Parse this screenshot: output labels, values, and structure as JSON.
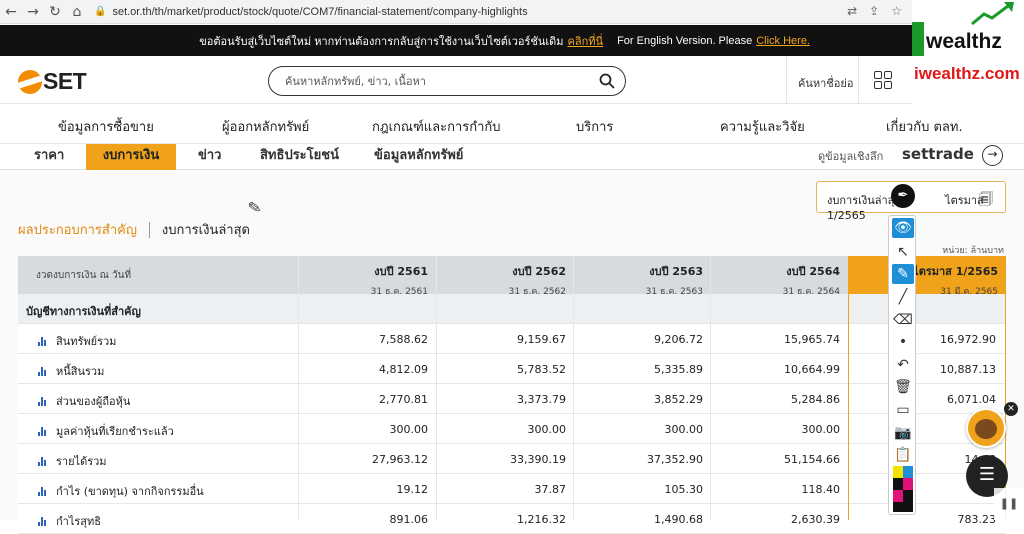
{
  "browser": {
    "url": "set.or.th/th/market/product/stock/quote/COM7/financial-statement/company-highlights"
  },
  "banner": {
    "text": "ขอต้อนรับสู่เว็บไซต์ใหม่ หากท่านต้องการกลับสู่การใช้งานเว็บไซต์เวอร์ชันเดิม",
    "link": "คลิกที่นี่",
    "english": "For English Version. Please",
    "english_link": "Click Here."
  },
  "watermark": {
    "brand": "wealthz",
    "site": "iwealthz.com"
  },
  "header": {
    "logo": "SET",
    "search_placeholder": "ค้นหาหลักทรัพย์, ข่าว, เนื้อหา",
    "quick_search": "ค้นหาชื่อย่อ"
  },
  "menu": [
    "ข้อมูลการซื้อขาย",
    "ผู้ออกหลักทรัพย์",
    "กฎเกณฑ์และการกำกับ",
    "บริการ",
    "ความรู้และวิจัย",
    "เกี่ยวกับ ตลท."
  ],
  "subtabs": {
    "items": [
      "ราคา",
      "งบการเงิน",
      "ข่าว",
      "สิทธิประโยชน์",
      "ข้อมูลหลักทรัพย์"
    ],
    "active": 1,
    "deep_data": "ดูข้อมูลเชิงลึก",
    "settrade": "settrade"
  },
  "period_select": {
    "label": "งบการเงินล่าสุด",
    "value": "ไตรมาส 1/2565"
  },
  "section_tabs": {
    "active": "ผลประกอบการสำคัญ",
    "other": "งบการเงินล่าสุด"
  },
  "unit": "หน่วย: ล้านบาท",
  "table": {
    "header_label": "งวดงบการเงิน ณ วันที่",
    "columns": [
      {
        "period": "งบปี 2561",
        "date": "31 ธ.ค. 2561"
      },
      {
        "period": "งบปี 2562",
        "date": "31 ธ.ค. 2562"
      },
      {
        "period": "งบปี 2563",
        "date": "31 ธ.ค. 2563"
      },
      {
        "period": "งบปี 2564",
        "date": "31 ธ.ค. 2564"
      },
      {
        "period": "ไตรมาส 1/2565",
        "date": "31 มี.ค. 2565"
      }
    ],
    "section_title": "บัญชีทางการเงินที่สำคัญ",
    "rows": [
      {
        "name": "สินทรัพย์รวม",
        "values": [
          "7,588.62",
          "9,159.67",
          "9,206.72",
          "15,965.74",
          "16,972.90"
        ]
      },
      {
        "name": "หนี้สินรวม",
        "values": [
          "4,812.09",
          "5,783.52",
          "5,335.89",
          "10,664.99",
          "10,887.13"
        ]
      },
      {
        "name": "ส่วนของผู้ถือหุ้น",
        "values": [
          "2,770.81",
          "3,373.79",
          "3,852.29",
          "5,284.86",
          "6,071.04"
        ]
      },
      {
        "name": "มูลค่าหุ้นที่เรียกชำระแล้ว",
        "values": [
          "300.00",
          "300.00",
          "300.00",
          "300.00",
          ""
        ]
      },
      {
        "name": "รายได้รวม",
        "values": [
          "27,963.12",
          "33,390.19",
          "37,352.90",
          "51,154.66",
          "14,68"
        ]
      },
      {
        "name": "กำไร (ขาดทุน) จากกิจกรรมอื่น",
        "values": [
          "19.12",
          "37.87",
          "105.30",
          "118.40",
          ""
        ]
      },
      {
        "name": "กำไรสุทธิ",
        "values": [
          "891.06",
          "1,216.32",
          "1,490.68",
          "2,630.39",
          "783.23"
        ]
      }
    ]
  },
  "colors": {
    "accent": "#f0a31a",
    "link_blue": "#2a62b8",
    "banner_bg": "#111111",
    "toolbar_select": "#1e8fd6"
  }
}
